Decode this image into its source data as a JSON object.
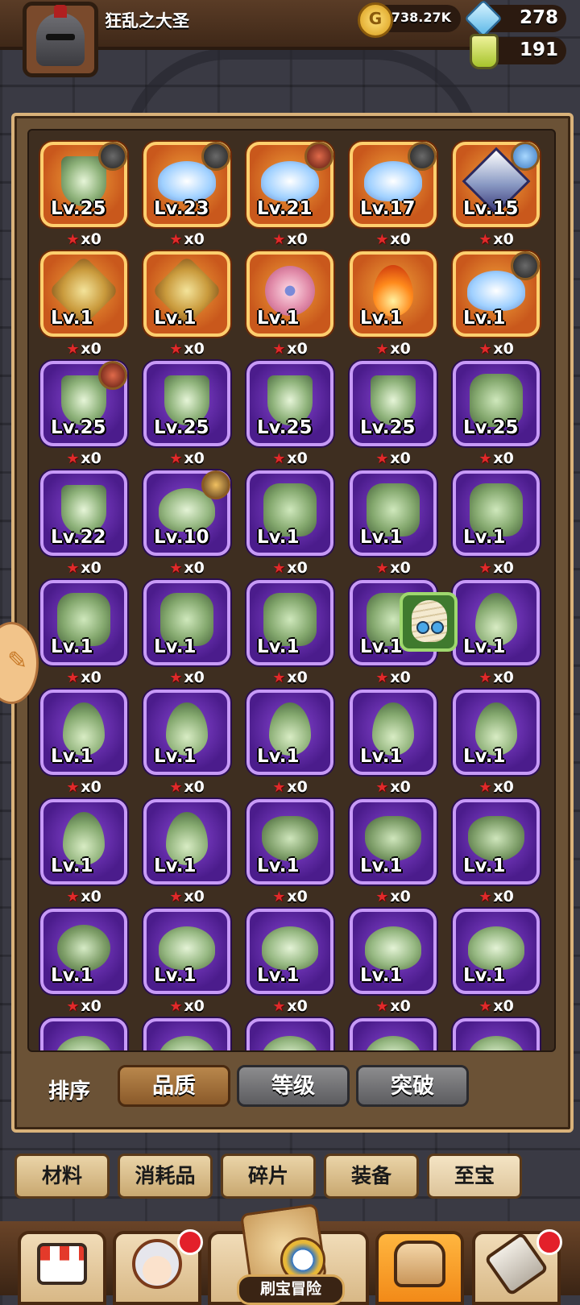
{
  "header": {
    "player_name": "狂乱之大圣",
    "coins": "738.27K",
    "gems": "278",
    "potions": "191"
  },
  "grid": {
    "items": [
      {
        "rarity": "orange",
        "icon": "green-crest-relic-icon",
        "level": "Lv.25",
        "stars": "x0",
        "badge": "helmet-hero"
      },
      {
        "rarity": "orange",
        "icon": "winged-crest-relic-icon",
        "level": "Lv.23",
        "stars": "x0",
        "badge": "helmet-hero"
      },
      {
        "rarity": "orange",
        "icon": "winged-crest-relic-icon",
        "level": "Lv.21",
        "stars": "x0",
        "badge": "red-eyed-hero"
      },
      {
        "rarity": "orange",
        "icon": "winged-crest-relic-icon",
        "level": "Lv.17",
        "stars": "x0",
        "badge": "bearded-hero"
      },
      {
        "rarity": "orange",
        "icon": "crystal-gem-relic-icon",
        "level": "Lv.15",
        "stars": "x0",
        "badge": "blue-hair-hero"
      },
      {
        "rarity": "orange",
        "icon": "golden-cross-relic-icon",
        "level": "Lv.1",
        "stars": "x0",
        "badge": ""
      },
      {
        "rarity": "orange",
        "icon": "golden-cross-relic-icon",
        "level": "Lv.1",
        "stars": "x0",
        "badge": ""
      },
      {
        "rarity": "orange",
        "icon": "pink-flower-relic-icon",
        "level": "Lv.1",
        "stars": "x0",
        "badge": ""
      },
      {
        "rarity": "orange",
        "icon": "fire-relic-icon",
        "level": "Lv.1",
        "stars": "x0",
        "badge": ""
      },
      {
        "rarity": "orange",
        "icon": "winged-crest-relic-icon",
        "level": "Lv.1",
        "stars": "x0",
        "badge": "masked-hero"
      },
      {
        "rarity": "purple",
        "icon": "horned-crest-relic-icon",
        "level": "Lv.25",
        "stars": "x0",
        "badge": "red-hero"
      },
      {
        "rarity": "purple",
        "icon": "horned-crest-relic-icon",
        "level": "Lv.25",
        "stars": "x0",
        "badge": ""
      },
      {
        "rarity": "purple",
        "icon": "horned-crest-relic-icon",
        "level": "Lv.25",
        "stars": "x0",
        "badge": ""
      },
      {
        "rarity": "purple",
        "icon": "horned-crest-relic-icon",
        "level": "Lv.25",
        "stars": "x0",
        "badge": ""
      },
      {
        "rarity": "purple",
        "icon": "clover-relic-icon",
        "level": "Lv.25",
        "stars": "x0",
        "badge": ""
      },
      {
        "rarity": "purple",
        "icon": "horned-crest-relic-icon",
        "level": "Lv.22",
        "stars": "x0",
        "badge": ""
      },
      {
        "rarity": "purple",
        "icon": "leaf-wings-relic-icon",
        "level": "Lv.10",
        "stars": "x0",
        "badge": "crowned-hero"
      },
      {
        "rarity": "purple",
        "icon": "clover-relic-icon",
        "level": "Lv.1",
        "stars": "x0",
        "badge": ""
      },
      {
        "rarity": "purple",
        "icon": "clover-relic-icon",
        "level": "Lv.1",
        "stars": "x0",
        "badge": ""
      },
      {
        "rarity": "purple",
        "icon": "clover-relic-icon",
        "level": "Lv.1",
        "stars": "x0",
        "badge": ""
      },
      {
        "rarity": "purple",
        "icon": "clover-relic-icon",
        "level": "Lv.1",
        "stars": "x0",
        "badge": ""
      },
      {
        "rarity": "purple",
        "icon": "clover-relic-icon",
        "level": "Lv.1",
        "stars": "x0",
        "badge": ""
      },
      {
        "rarity": "purple",
        "icon": "clover-relic-icon",
        "level": "Lv.1",
        "stars": "x0",
        "badge": ""
      },
      {
        "rarity": "purple",
        "icon": "clover-relic-icon",
        "level": "Lv.1",
        "stars": "x0",
        "badge": ""
      },
      {
        "rarity": "purple",
        "icon": "green-flame-relic-icon",
        "level": "Lv.1",
        "stars": "x0",
        "badge": ""
      },
      {
        "rarity": "purple",
        "icon": "green-flame-relic-icon",
        "level": "Lv.1",
        "stars": "x0",
        "badge": ""
      },
      {
        "rarity": "purple",
        "icon": "green-flame-relic-icon",
        "level": "Lv.1",
        "stars": "x0",
        "badge": ""
      },
      {
        "rarity": "purple",
        "icon": "green-flame-relic-icon",
        "level": "Lv.1",
        "stars": "x0",
        "badge": ""
      },
      {
        "rarity": "purple",
        "icon": "green-flame-relic-icon",
        "level": "Lv.1",
        "stars": "x0",
        "badge": ""
      },
      {
        "rarity": "purple",
        "icon": "green-flame-relic-icon",
        "level": "Lv.1",
        "stars": "x0",
        "badge": ""
      },
      {
        "rarity": "purple",
        "icon": "green-flame-relic-icon",
        "level": "Lv.1",
        "stars": "x0",
        "badge": ""
      },
      {
        "rarity": "purple",
        "icon": "green-flame-relic-icon",
        "level": "Lv.1",
        "stars": "x0",
        "badge": ""
      },
      {
        "rarity": "purple",
        "icon": "horned-beast-relic-icon",
        "level": "Lv.1",
        "stars": "x0",
        "badge": ""
      },
      {
        "rarity": "purple",
        "icon": "horned-beast-relic-icon",
        "level": "Lv.1",
        "stars": "x0",
        "badge": ""
      },
      {
        "rarity": "purple",
        "icon": "horned-beast-relic-icon",
        "level": "Lv.1",
        "stars": "x0",
        "badge": ""
      },
      {
        "rarity": "purple",
        "icon": "orb-cluster-relic-icon",
        "level": "Lv.1",
        "stars": "x0",
        "badge": ""
      },
      {
        "rarity": "purple",
        "icon": "leaf-wings-relic-icon",
        "level": "Lv.1",
        "stars": "x0",
        "badge": ""
      },
      {
        "rarity": "purple",
        "icon": "leaf-wings-relic-icon",
        "level": "Lv.1",
        "stars": "x0",
        "badge": ""
      },
      {
        "rarity": "purple",
        "icon": "leaf-wings-relic-icon",
        "level": "Lv.1",
        "stars": "x0",
        "badge": ""
      },
      {
        "rarity": "purple",
        "icon": "leaf-wings-relic-icon",
        "level": "Lv.1",
        "stars": "x0",
        "badge": ""
      },
      {
        "rarity": "purple",
        "icon": "leaf-wings-relic-icon",
        "level": "",
        "stars": "",
        "badge": ""
      },
      {
        "rarity": "purple",
        "icon": "leaf-wings-relic-icon",
        "level": "",
        "stars": "",
        "badge": ""
      },
      {
        "rarity": "purple",
        "icon": "leaf-wings-relic-icon",
        "level": "",
        "stars": "",
        "badge": ""
      },
      {
        "rarity": "purple",
        "icon": "leaf-wings-relic-icon",
        "level": "",
        "stars": "",
        "badge": ""
      },
      {
        "rarity": "purple",
        "icon": "leaf-wings-relic-icon",
        "level": "",
        "stars": "",
        "badge": ""
      }
    ]
  },
  "sort": {
    "label": "排序",
    "options": [
      "品质",
      "等级",
      "突破"
    ],
    "active": "品质"
  },
  "categories": {
    "tabs": [
      "材料",
      "消耗品",
      "碎片",
      "装备",
      "至宝"
    ],
    "active": "至宝"
  },
  "bottom_nav": {
    "adventure_label": "刷宝冒险",
    "items": [
      "shop-icon",
      "hero-icon",
      "adventure-map-icon",
      "backpack-icon",
      "forge-hammer-icon"
    ]
  }
}
